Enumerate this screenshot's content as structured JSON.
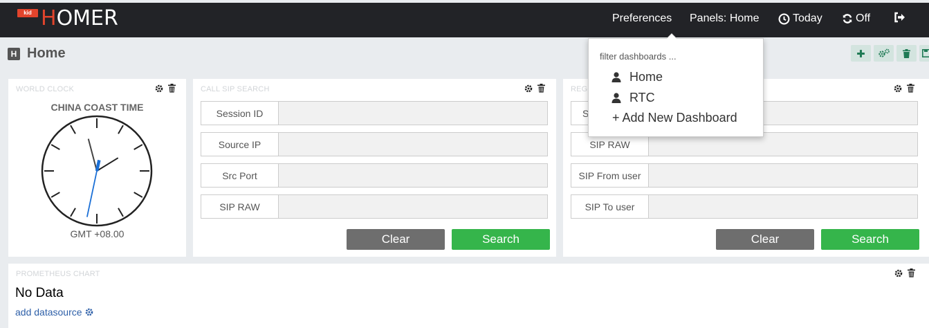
{
  "app": {
    "logo_badge": "kid",
    "logo_first": "H",
    "logo_rest": "OMER"
  },
  "nav": {
    "preferences": "Preferences",
    "panels": "Panels: Home",
    "today": "Today",
    "refresh": "Off"
  },
  "page": {
    "title": "Home",
    "title_icon_letter": "H"
  },
  "dropdown": {
    "filter_placeholder": "filter dashboards ...",
    "items": [
      {
        "label": "Home"
      },
      {
        "label": "RTC"
      }
    ],
    "add_label": "+ Add New Dashboard"
  },
  "world_clock": {
    "panel_title": "World Clock",
    "city": "CHINA COAST TIME",
    "timezone": "GMT +08.00",
    "time": {
      "hour": 1,
      "minute": 57,
      "second": 32
    }
  },
  "call_sip_search": {
    "panel_title": "Call SIP Search",
    "fields": [
      {
        "label": "Session ID",
        "value": ""
      },
      {
        "label": "Source IP",
        "value": ""
      },
      {
        "label": "Src Port",
        "value": ""
      },
      {
        "label": "SIP RAW",
        "value": ""
      }
    ],
    "clear_label": "Clear",
    "search_label": "Search"
  },
  "registration_search": {
    "panel_title": "Regi",
    "fields": [
      {
        "label": "S",
        "value": ""
      },
      {
        "label": "SIP RAW",
        "value": ""
      },
      {
        "label": "SIP From user",
        "value": ""
      },
      {
        "label": "SIP To user",
        "value": ""
      }
    ],
    "clear_label": "Clear",
    "search_label": "Search"
  },
  "prometheus": {
    "panel_title": "Prometheus Chart",
    "no_data": "No Data",
    "add_datasource": "add datasource"
  },
  "colors": {
    "topbar": "#222327",
    "brand_red": "#e2442c",
    "search_green": "#35b54b",
    "clear_gray": "#6e6e6e",
    "link_blue": "#2d5fa8"
  }
}
